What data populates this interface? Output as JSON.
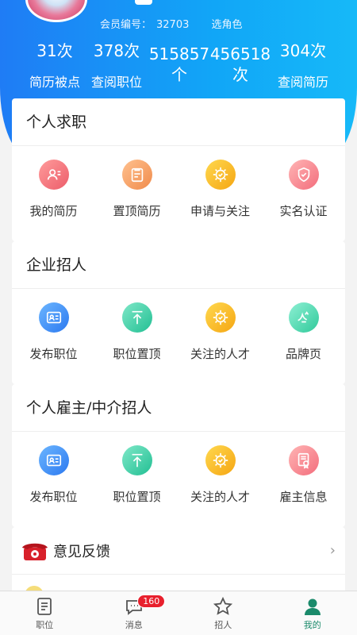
{
  "header": {
    "member_id_label": "会员编号：",
    "member_id": "32703",
    "color_link": "选角色"
  },
  "stats": [
    {
      "value": "31次",
      "label": "简历被点"
    },
    {
      "value": "378次",
      "label": "查阅职位"
    },
    {
      "value": "515857个",
      "label": ""
    },
    {
      "value": "456518次",
      "label": ""
    },
    {
      "value": "304次",
      "label": "查阅简历"
    }
  ],
  "sections": {
    "personal": {
      "title": "个人求职",
      "items": [
        "我的简历",
        "置顶简历",
        "申请与关注",
        "实名认证"
      ]
    },
    "company": {
      "title": "企业招人",
      "items": [
        "发布职位",
        "职位置顶",
        "关注的人才",
        "品牌页"
      ]
    },
    "agent": {
      "title": "个人雇主/中介招人",
      "items": [
        "发布职位",
        "职位置顶",
        "关注的人才",
        "雇主信息"
      ]
    }
  },
  "feedback": {
    "label": "意见反馈",
    "chevron": "›"
  },
  "tabbar": {
    "items": [
      {
        "label": "职位",
        "icon": "document-icon"
      },
      {
        "label": "消息",
        "icon": "chat-icon",
        "badge": "160"
      },
      {
        "label": "招人",
        "icon": "star-icon"
      },
      {
        "label": "我的",
        "icon": "person-icon",
        "active": true
      }
    ]
  },
  "colors": {
    "accent": "#1296f5",
    "active_tab": "#1b8a6b",
    "badge": "#e8202d"
  }
}
